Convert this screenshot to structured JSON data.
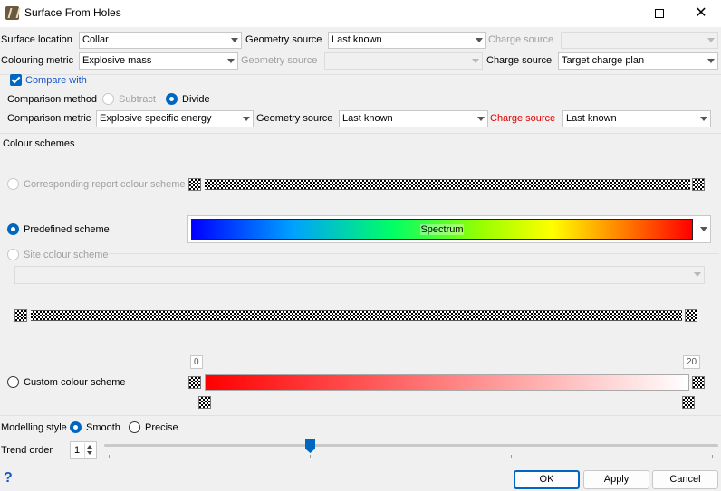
{
  "window": {
    "title": "Surface From Holes",
    "minimize_icon": "minimize-icon",
    "maximize_icon": "maximize-icon",
    "close_icon": "close-icon"
  },
  "row1": {
    "surface_location_label": "Surface location",
    "surface_location_value": "Collar",
    "geometry_source_label": "Geometry source",
    "geometry_source_value": "Last known",
    "charge_source_label": "Charge source",
    "charge_source_value": ""
  },
  "row2": {
    "colouring_metric_label": "Colouring metric",
    "colouring_metric_value": "Explosive mass",
    "geometry_source_label": "Geometry source",
    "geometry_source_value": "",
    "charge_source_label": "Charge source",
    "charge_source_value": "Target charge plan"
  },
  "compare": {
    "compare_with_label": "Compare with",
    "compare_with_checked": true,
    "method_label": "Comparison method",
    "subtract_label": "Subtract",
    "divide_label": "Divide",
    "selected_method": "Divide",
    "metric_label": "Comparison metric",
    "metric_value": "Explosive specific energy",
    "geometry_source_label": "Geometry source",
    "geometry_source_value": "Last known",
    "charge_source_label": "Charge source",
    "charge_source_value": "Last known"
  },
  "colour_schemes": {
    "section_label": "Colour schemes",
    "corresponding_label": "Corresponding report colour scheme",
    "predefined_label": "Predefined scheme",
    "predefined_value": "Spectrum",
    "site_label": "Site colour scheme",
    "site_value": "",
    "custom_label": "Custom colour scheme",
    "custom_min": "0",
    "custom_max": "20",
    "selected": "Predefined scheme",
    "colors": {
      "custom_start": "#ff0000",
      "custom_end": "#ffffff"
    }
  },
  "modelling": {
    "style_label": "Modelling style",
    "smooth_label": "Smooth",
    "precise_label": "Precise",
    "selected_style": "Smooth",
    "trend_order_label": "Trend order",
    "trend_order_value": "1"
  },
  "buttons": {
    "ok": "OK",
    "apply": "Apply",
    "cancel": "Cancel"
  },
  "help_icon": "help-icon",
  "accent_color": "#0067c0"
}
